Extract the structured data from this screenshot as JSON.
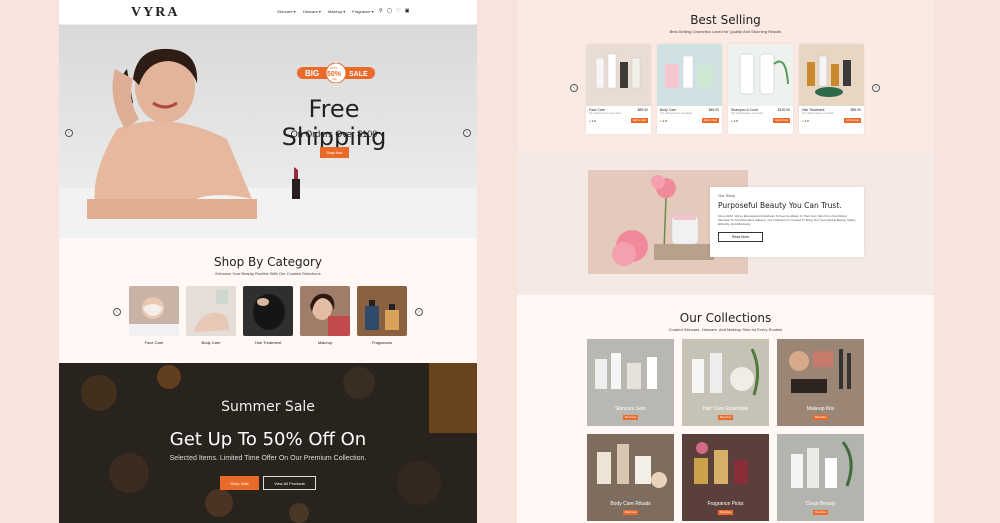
{
  "brand": "VYRA",
  "nav": {
    "links": [
      "Skincare",
      "Haircare",
      "Makeup",
      "Fragrance"
    ],
    "icons": [
      "search-icon",
      "user-icon",
      "heart-icon",
      "cart-icon"
    ]
  },
  "hero": {
    "badge_big": "BIG",
    "badge_upto": "UP TO",
    "badge_pct": "50%",
    "badge_off": "OFF",
    "badge_sale": "SALE",
    "title": "Free Shipping",
    "subtitle": "On Orders Over $100",
    "button": "Shop Now"
  },
  "shop_by_category": {
    "title": "Shop By Category",
    "subtitle": "Enhance Your Beauty Routine With Our Curated Selections",
    "items": [
      {
        "label": "Face Care",
        "color": "#c9b3a6"
      },
      {
        "label": "Body Care",
        "color": "#e4ddd8"
      },
      {
        "label": "Hair Treatment",
        "color": "#2f2f2f"
      },
      {
        "label": "Makeup",
        "color": "#a07d68"
      },
      {
        "label": "Fragrances",
        "color": "#8a6242"
      }
    ]
  },
  "summer_sale": {
    "title": "Summer Sale",
    "headline": "Get Up To 50% Off On",
    "subtitle": "Selected Items. Limited Time Offer On Our Premium Collection.",
    "primary_button": "Shop Sale",
    "secondary_button": "View All Products"
  },
  "best_selling": {
    "title": "Best Selling",
    "subtitle": "Best-Selling Cosmetics Loved for Quality And Stunning Results",
    "products": [
      {
        "name": "Face Care",
        "price": "$89.00",
        "desc": "Top selling beauty essentials",
        "rating": "4.8",
        "button": "Add to Cart",
        "color": "#e9ddd3"
      },
      {
        "name": "Body Care",
        "price": "$45.00",
        "desc": "Top selling beauty essentials",
        "rating": "4.8",
        "button": "Add to Cart",
        "color": "#cfe1e3"
      },
      {
        "name": "Shampoo & Cond",
        "price": "$120.00",
        "desc": "Top selling beauty essentials",
        "rating": "4.8",
        "button": "Add to Cart",
        "color": "#eef2ef"
      },
      {
        "name": "Hair Treatment",
        "price": "$55.00",
        "desc": "Top selling beauty essentials",
        "rating": "4.8",
        "button": "Add to Cart",
        "color": "#e8d6c4"
      }
    ]
  },
  "story": {
    "kicker": "Our Story",
    "title": "Purposeful Beauty You Can Trust.",
    "body": "Since 2010, We've Empowered Individuals To Feel Confident In Their Own Skin From Nourishing Skincare To Transformative Makeup, Our Collection Is Curated To Bring Out Your Natural Beauty Safely, Ethically, And Effectively.",
    "button": "Read More"
  },
  "collections": {
    "title": "Our Collections",
    "subtitle": "Curated Skincare, Haircare, And Makeup Sets for Every Routine",
    "items": [
      {
        "label": "Skincare Sets",
        "button": "Shop Now",
        "color": "#b9b7b2"
      },
      {
        "label": "Hair Care Essentials",
        "button": "Shop Now",
        "color": "#c7c2b6"
      },
      {
        "label": "Makeup Kits",
        "button": "Shop Now",
        "color": "#9b8676"
      },
      {
        "label": "Body Care Rituals",
        "button": "Shop Now",
        "color": "#7e6c5e"
      },
      {
        "label": "Fragrance Picks",
        "button": "Shop Now",
        "color": "#5a3f3a"
      },
      {
        "label": "Clean Beauty",
        "button": "Shop Now",
        "color": "#b3b4ad"
      }
    ]
  }
}
